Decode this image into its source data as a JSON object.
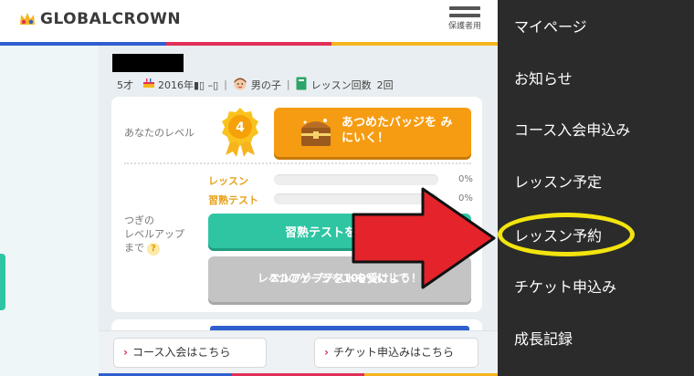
{
  "header": {
    "logo_text": "GLOBALCROWN",
    "menu_label": "保護者用"
  },
  "profile": {
    "age": "5才",
    "birth": "2016年▮▯ –▯",
    "gender": "男の子",
    "lesson_count_label": "レッスン回数",
    "lesson_count": "2回"
  },
  "level": {
    "label": "あなたのレベル",
    "value": "4",
    "badge_button_label": "あつめたバッジを みにいく！"
  },
  "gauges": [
    {
      "label": "レッスン",
      "percent_text": "0%",
      "value": 0
    },
    {
      "label": "習熟テスト",
      "percent_text": "0%",
      "value": 0
    }
  ],
  "next_level": {
    "label_line1": "つぎの",
    "label_line2": "レベルアップ",
    "label_line3": "まで",
    "help": "?"
  },
  "test_button_label": "習熟テストを",
  "levelup_button": {
    "line1": "2つのゲージを100%にして",
    "line2": "レベルアップテストを受けよう！"
  },
  "bottom_bar": {
    "course_button": "コース入会はこちら",
    "ticket_button": "チケット申込みはこちら"
  },
  "side_menu": {
    "items": [
      {
        "label": "マイページ"
      },
      {
        "label": "お知らせ"
      },
      {
        "label": "コース入会申込み"
      },
      {
        "label": "レッスン予定"
      },
      {
        "label": "レッスン予約",
        "highlighted": true
      },
      {
        "label": "チケット申込み"
      },
      {
        "label": "成長記録"
      }
    ]
  },
  "colors": {
    "brand_stripe": [
      "#2f5fcf",
      "#e0305a",
      "#f6b51e"
    ],
    "menu_bg": "#2b2b2b",
    "highlight": "#f3e40f",
    "arrow": "#e4232b",
    "teal": "#2fc5a3",
    "orange": "#f69c12"
  }
}
